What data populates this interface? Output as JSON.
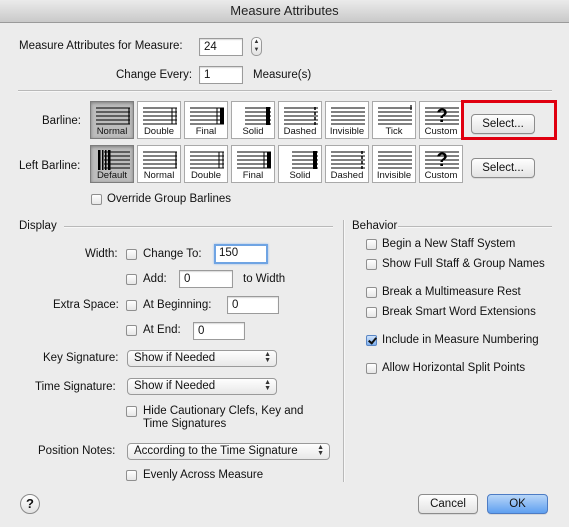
{
  "window": {
    "title": "Measure Attributes"
  },
  "top": {
    "for_measure_label": "Measure Attributes for Measure:",
    "for_measure_value": "24",
    "change_every_label": "Change Every:",
    "change_every_value": "1",
    "measures_suffix": "Measure(s)"
  },
  "barline": {
    "label": "Barline:",
    "options": [
      "Normal",
      "Double",
      "Final",
      "Solid",
      "Dashed",
      "Invisible",
      "Tick",
      "Custom"
    ],
    "selected": "Normal",
    "select_button": "Select..."
  },
  "left_barline": {
    "label": "Left Barline:",
    "options": [
      "Default",
      "Normal",
      "Double",
      "Final",
      "Solid",
      "Dashed",
      "Invisible",
      "Custom"
    ],
    "selected": "Default",
    "select_button": "Select..."
  },
  "override_group_barlines": {
    "label": "Override Group Barlines",
    "checked": false
  },
  "display": {
    "section_label": "Display",
    "width_label": "Width:",
    "change_to_label": "Change To:",
    "change_to_value": "150",
    "add_label": "Add:",
    "add_value": "0",
    "to_width_label": "to Width",
    "extra_space_label": "Extra Space:",
    "at_beginning_label": "At Beginning:",
    "at_beginning_value": "0",
    "at_end_label": "At End:",
    "at_end_value": "0",
    "key_signature_label": "Key Signature:",
    "key_signature_value": "Show if Needed",
    "time_signature_label": "Time Signature:",
    "time_signature_value": "Show if Needed",
    "hide_cautionary_line1": "Hide Cautionary Clefs, Key and",
    "hide_cautionary_line2": "Time Signatures",
    "position_notes_label": "Position Notes:",
    "position_notes_value": "According to the Time Signature",
    "evenly_label": "Evenly Across Measure"
  },
  "behavior": {
    "section_label": "Behavior",
    "items": [
      {
        "label": "Begin a New Staff System",
        "checked": false
      },
      {
        "label": "Show Full Staff & Group Names",
        "checked": false
      },
      {
        "label": "Break a Multimeasure Rest",
        "checked": false
      },
      {
        "label": "Break Smart Word Extensions",
        "checked": false
      },
      {
        "label": "Include in Measure Numbering",
        "checked": true
      },
      {
        "label": "Allow Horizontal Split Points",
        "checked": false
      }
    ]
  },
  "footer": {
    "help": "?",
    "cancel": "Cancel",
    "ok": "OK"
  },
  "colors": {
    "highlight_box": "#e00010",
    "default_button": "#5f9ff0"
  }
}
